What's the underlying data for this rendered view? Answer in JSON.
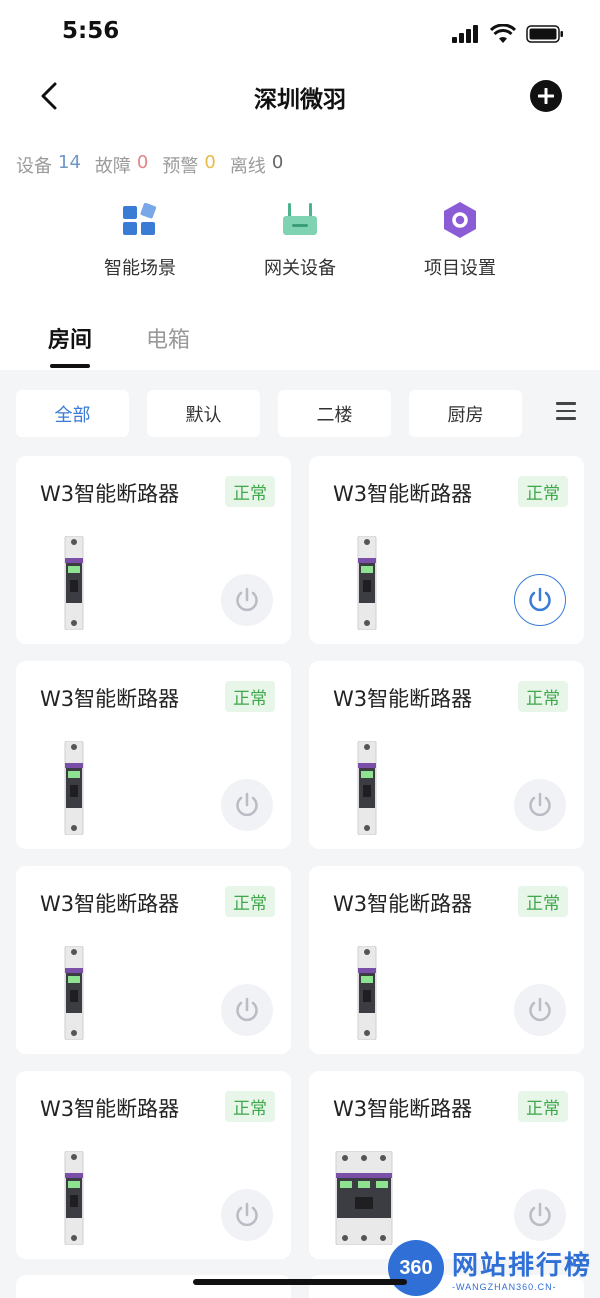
{
  "status_bar": {
    "time": "5:56"
  },
  "nav": {
    "title": "深圳微羽"
  },
  "stats": {
    "devices_label": "设备",
    "devices_value": "14",
    "faults_label": "故障",
    "faults_value": "0",
    "warnings_label": "预警",
    "warnings_value": "0",
    "offline_label": "离线",
    "offline_value": "0"
  },
  "quick_actions": [
    {
      "label": "智能场景",
      "icon": "scene-grid-icon",
      "color": "#3a7bd5"
    },
    {
      "label": "网关设备",
      "icon": "router-icon",
      "color": "#4cb28a"
    },
    {
      "label": "项目设置",
      "icon": "hexagon-settings-icon",
      "color": "#8a5cd6"
    }
  ],
  "tabs": [
    {
      "label": "房间",
      "active": true
    },
    {
      "label": "电箱",
      "active": false
    }
  ],
  "filters": [
    {
      "label": "全部",
      "active": true
    },
    {
      "label": "默认",
      "active": false
    },
    {
      "label": "二楼",
      "active": false
    },
    {
      "label": "厨房",
      "active": false
    }
  ],
  "devices": [
    {
      "name": "W3智能断路器",
      "status": "正常",
      "power_on": false,
      "image": "single-breaker"
    },
    {
      "name": "W3智能断路器",
      "status": "正常",
      "power_on": true,
      "image": "single-breaker"
    },
    {
      "name": "W3智能断路器",
      "status": "正常",
      "power_on": false,
      "image": "single-breaker"
    },
    {
      "name": "W3智能断路器",
      "status": "正常",
      "power_on": false,
      "image": "single-breaker"
    },
    {
      "name": "W3智能断路器",
      "status": "正常",
      "power_on": false,
      "image": "single-breaker"
    },
    {
      "name": "W3智能断路器",
      "status": "正常",
      "power_on": false,
      "image": "single-breaker"
    },
    {
      "name": "W3智能断路器",
      "status": "正常",
      "power_on": false,
      "image": "single-breaker"
    },
    {
      "name": "W3智能断路器",
      "status": "正常",
      "power_on": false,
      "image": "triple-breaker"
    }
  ],
  "watermark": {
    "logo": "360",
    "main": "网站排行榜",
    "sub": "-WANGZHAN360.CN-"
  },
  "colors": {
    "accent": "#3a7bd5",
    "ok_green": "#3ea84b",
    "fault_red": "#e1858a",
    "warn_yellow": "#e6bb4a"
  }
}
